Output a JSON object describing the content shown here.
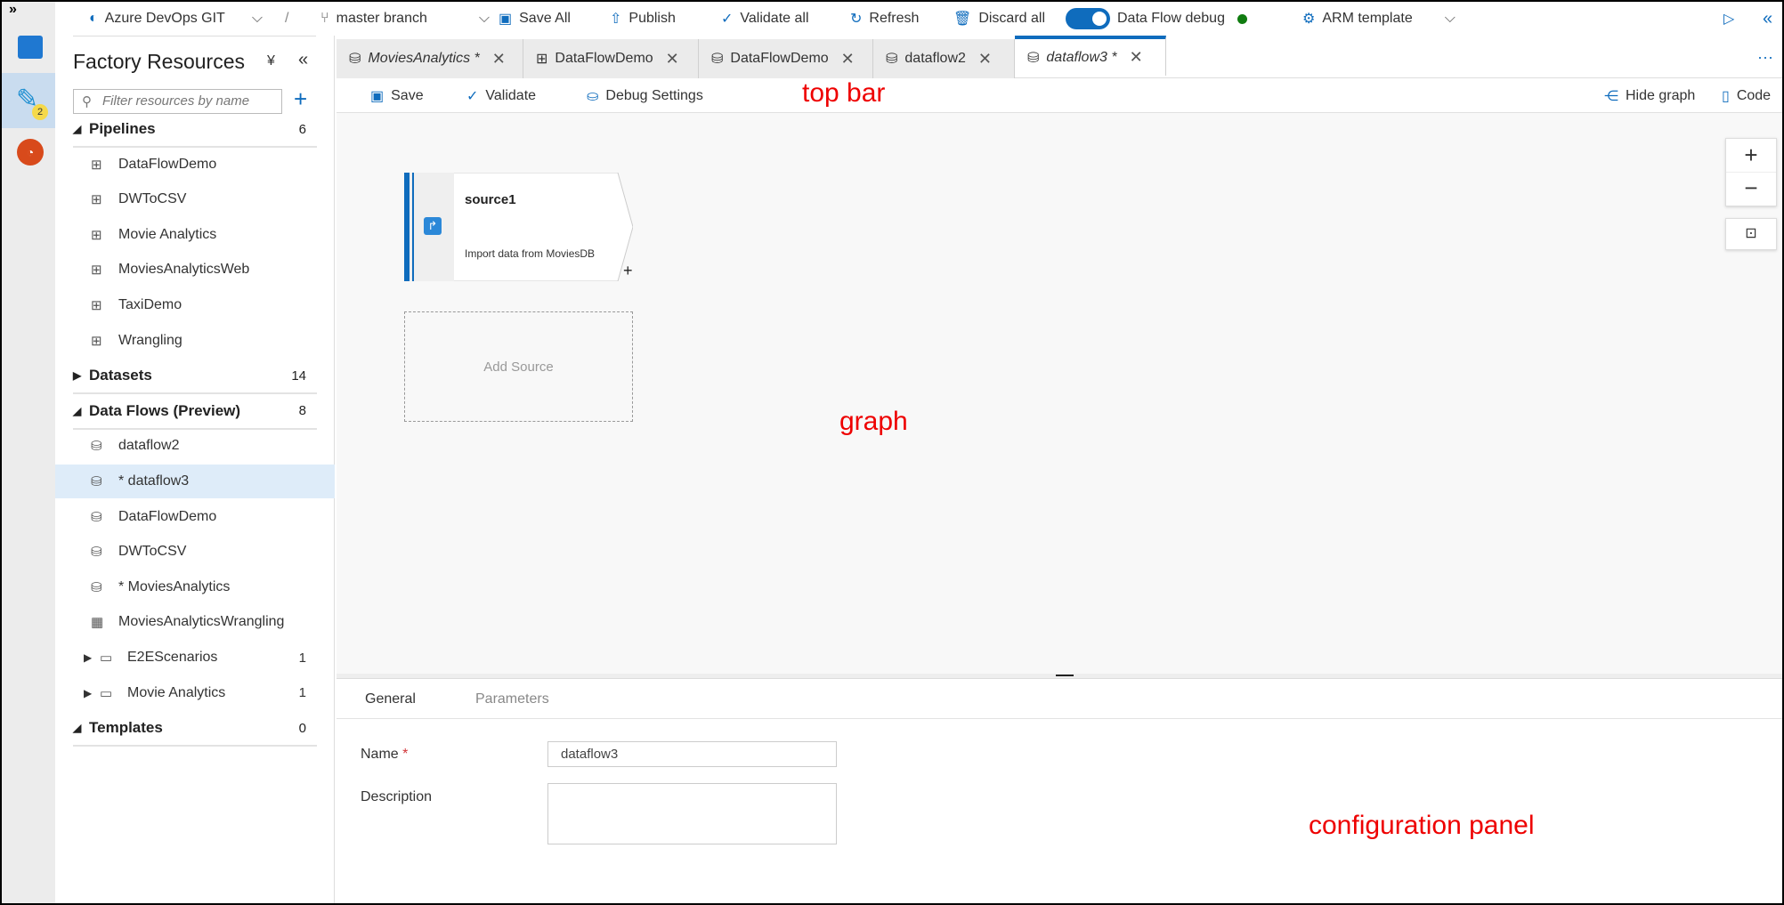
{
  "rail": {
    "expand": "»",
    "badge": "2"
  },
  "toolbar": {
    "repo": "Azure DevOps GIT",
    "sep": "/",
    "branch": "master branch",
    "save_all": "Save All",
    "publish": "Publish",
    "validate_all": "Validate all",
    "refresh": "Refresh",
    "discard_all": "Discard all",
    "debug_label": "Data Flow debug",
    "debug_on": true,
    "arm": "ARM template",
    "collapse": "«"
  },
  "sidebar": {
    "title": "Factory Resources",
    "filter_placeholder": "Filter resources by name",
    "pipelines": {
      "label": "Pipelines",
      "count": "6",
      "items": [
        "DataFlowDemo",
        "DWToCSV",
        "Movie Analytics",
        "MoviesAnalyticsWeb",
        "TaxiDemo",
        "Wrangling"
      ]
    },
    "datasets": {
      "label": "Datasets",
      "count": "14"
    },
    "dataflows": {
      "label": "Data Flows (Preview)",
      "count": "8",
      "items": [
        "dataflow2",
        "* dataflow3",
        "DataFlowDemo",
        "DWToCSV",
        "* MoviesAnalytics",
        "MoviesAnalyticsWrangling"
      ]
    },
    "folders": [
      {
        "label": "E2EScenarios",
        "count": "1"
      },
      {
        "label": "Movie Analytics",
        "count": "1"
      }
    ],
    "templates": {
      "label": "Templates",
      "count": "0"
    }
  },
  "tabs": [
    {
      "label": "MoviesAnalytics *"
    },
    {
      "label": "DataFlowDemo"
    },
    {
      "label": "DataFlowDemo"
    },
    {
      "label": "dataflow2"
    },
    {
      "label": "dataflow3 *"
    }
  ],
  "tabs_more": "···",
  "subbar": {
    "save": "Save",
    "validate": "Validate",
    "debug_settings": "Debug Settings",
    "hide_graph": "Hide graph",
    "code": "Code",
    "annotation": "top bar"
  },
  "graph": {
    "node_title": "source1",
    "node_desc": "Import data from MoviesDB",
    "add_source": "Add Source",
    "annotation": "graph"
  },
  "config": {
    "tabs": [
      "General",
      "Parameters"
    ],
    "name_label": "Name",
    "required": "*",
    "name_value": "dataflow3",
    "description_label": "Description",
    "description_value": "",
    "annotation": "configuration panel"
  }
}
